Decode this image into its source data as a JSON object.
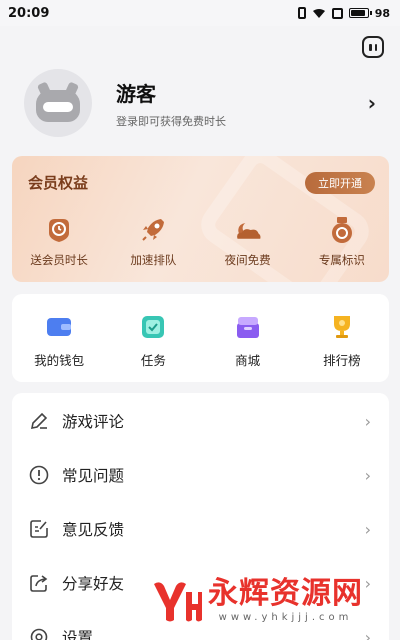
{
  "status_bar": {
    "time": "20:09",
    "battery": "98"
  },
  "header": {
    "message_icon": "message-icon"
  },
  "profile": {
    "name": "游客",
    "subtitle": "登录即可获得免费时长",
    "arrow": "›"
  },
  "vip": {
    "title": "会员权益",
    "button": "立即开通",
    "items": [
      {
        "label": "送会员时长",
        "icon": "clock-badge-icon"
      },
      {
        "label": "加速排队",
        "icon": "rocket-icon"
      },
      {
        "label": "夜间免费",
        "icon": "night-cloud-icon"
      },
      {
        "label": "专属标识",
        "icon": "medal-icon"
      }
    ]
  },
  "quick": {
    "items": [
      {
        "label": "我的钱包",
        "icon": "wallet-icon"
      },
      {
        "label": "任务",
        "icon": "task-icon"
      },
      {
        "label": "商城",
        "icon": "store-icon"
      },
      {
        "label": "排行榜",
        "icon": "trophy-icon"
      }
    ]
  },
  "menu": {
    "items": [
      {
        "label": "游戏评论",
        "icon": "pencil-icon"
      },
      {
        "label": "常见问题",
        "icon": "info-icon"
      },
      {
        "label": "意见反馈",
        "icon": "feedback-icon"
      },
      {
        "label": "分享好友",
        "icon": "share-icon"
      },
      {
        "label": "设置",
        "icon": "gear-icon"
      }
    ],
    "arrow": "›"
  },
  "watermark": {
    "brand": "永辉资源网",
    "url": "www.yhkjjj.com"
  },
  "colors": {
    "accent": "#b86b3c",
    "vip_text": "#7a3d1c",
    "watermark": "#e8322c"
  }
}
